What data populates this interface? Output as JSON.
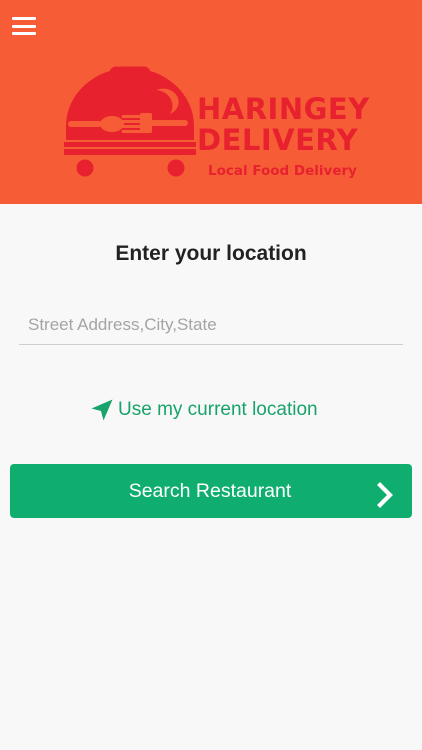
{
  "header": {
    "menu_icon": "hamburger-menu-icon",
    "background_color": "#f65c36",
    "logo": {
      "icon": "food-cart-cloche-with-spoon-fork-icon",
      "brand_line1": "HARINGEY",
      "brand_line2": "DELIVERY",
      "tagline": "Local Food Delivery",
      "color": "#e8212e"
    }
  },
  "location": {
    "title": "Enter your location",
    "address_placeholder": "Street Address,City,State",
    "address_value": "",
    "use_current_location_label": "Use my current location",
    "use_current_location_icon": "navigation-arrow-icon"
  },
  "search_button": {
    "label": "Search Restaurant",
    "icon": "chevron-right-icon",
    "color": "#10ae6e"
  },
  "colors": {
    "accent_green": "#18a36a",
    "page_background": "#f8f8f8"
  }
}
